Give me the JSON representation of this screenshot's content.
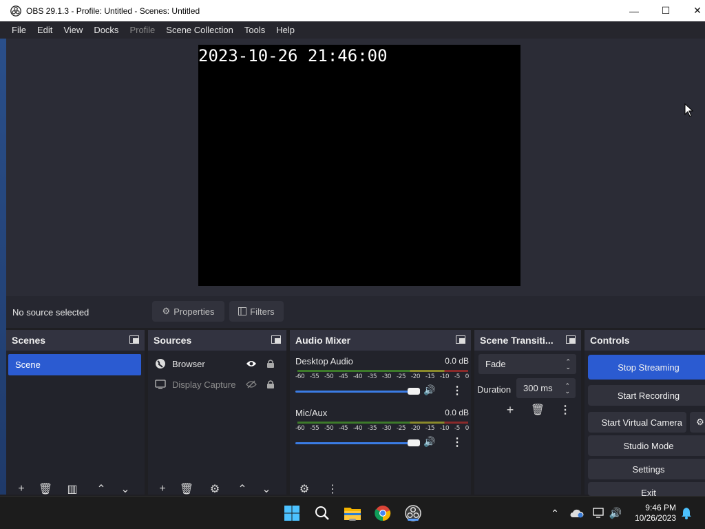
{
  "window": {
    "title": "OBS 29.1.3 - Profile: Untitled - Scenes: Untitled",
    "minimize": "—",
    "maximize": "☐",
    "close": "✕"
  },
  "menu": [
    "File",
    "Edit",
    "View",
    "Docks",
    "Profile",
    "Scene Collection",
    "Tools",
    "Help"
  ],
  "preview": {
    "clock_text": "2023-10-26 21:46:00"
  },
  "source_toolbar": {
    "status": "No source selected",
    "properties_label": "Properties",
    "filters_label": "Filters"
  },
  "scenes": {
    "title": "Scenes",
    "items": [
      "Scene"
    ]
  },
  "sources": {
    "title": "Sources",
    "items": [
      {
        "name": "Browser",
        "visible": true,
        "type": "globe"
      },
      {
        "name": "Display Capture",
        "visible": false,
        "type": "monitor"
      }
    ]
  },
  "mixer": {
    "title": "Audio Mixer",
    "tracks": [
      {
        "name": "Desktop Audio",
        "db": "0.0 dB"
      },
      {
        "name": "Mic/Aux",
        "db": "0.0 dB"
      }
    ],
    "ticks": [
      "-60",
      "-55",
      "-50",
      "-45",
      "-40",
      "-35",
      "-30",
      "-25",
      "-20",
      "-15",
      "-10",
      "-5",
      "0"
    ]
  },
  "transitions": {
    "title": "Scene Transiti...",
    "type": "Fade",
    "duration_label": "Duration",
    "duration_value": "300 ms"
  },
  "controls": {
    "title": "Controls",
    "stop_streaming": "Stop Streaming",
    "start_recording": "Start Recording",
    "start_virtual_camera": "Start Virtual Camera",
    "studio_mode": "Studio Mode",
    "settings": "Settings",
    "exit": "Exit"
  },
  "taskbar": {
    "time": "9:46 PM",
    "date": "10/26/2023"
  },
  "colors": {
    "accent": "#2b5bd1",
    "panel": "#2a2a33",
    "preview_bg": "#2b2c36"
  }
}
